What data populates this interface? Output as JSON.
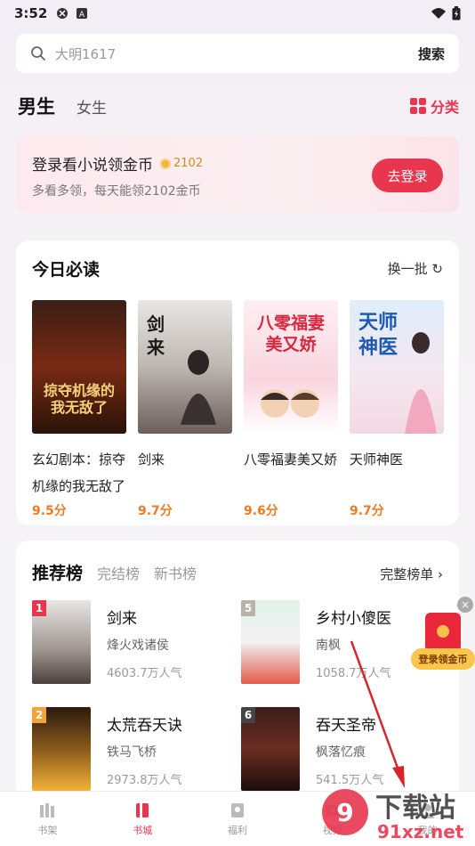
{
  "status": {
    "time": "3:52"
  },
  "search": {
    "placeholder": "大明1617",
    "button": "搜索"
  },
  "gender_tabs": {
    "male": "男生",
    "female": "女生",
    "category": "分类"
  },
  "login_card": {
    "title": "登录看小说领金币",
    "coins": "2102",
    "subtitle": "多看多领，每天能领2102金币",
    "button": "去登录"
  },
  "must_read": {
    "title": "今日必读",
    "refresh": "换一批",
    "books": [
      {
        "name": "玄幻剧本：掠夺机缘的我无敌了",
        "score": "9.5分",
        "cover_text": "掠夺机缘的我无敌了"
      },
      {
        "name": "剑来",
        "score": "9.7分",
        "cover_text": "剑来"
      },
      {
        "name": "八零福妻美又娇",
        "score": "9.6分",
        "cover_text": "八零福妻美又娇"
      },
      {
        "name": "天师神医",
        "score": "9.7分",
        "cover_text": "天师神医"
      }
    ]
  },
  "ranking": {
    "tabs": [
      "推荐榜",
      "完结榜",
      "新书榜"
    ],
    "full": "完整榜单",
    "items": [
      {
        "rank": "1",
        "title": "剑来",
        "author": "烽火戏诸侯",
        "popularity": "4603.7万人气"
      },
      {
        "rank": "5",
        "title": "乡村小傻医",
        "author": "南枫",
        "popularity": "1058.7万人气"
      },
      {
        "rank": "2",
        "title": "太荒吞天诀",
        "author": "铁马飞桥",
        "popularity": "2973.8万人气"
      },
      {
        "rank": "6",
        "title": "吞天圣帝",
        "author": "枫落忆痕",
        "popularity": "541.5万人气"
      }
    ]
  },
  "float_ad": {
    "label": "登录领金币"
  },
  "bottom_nav": [
    {
      "label": "书架"
    },
    {
      "label": "书城"
    },
    {
      "label": "福利"
    },
    {
      "label": "视频"
    },
    {
      "label": "我的"
    }
  ],
  "watermark": {
    "text": "下载站",
    "domain": "91xz.net"
  },
  "colors": {
    "accent": "#e8364f",
    "score": "#f07a22",
    "coin": "#f4b43b"
  }
}
